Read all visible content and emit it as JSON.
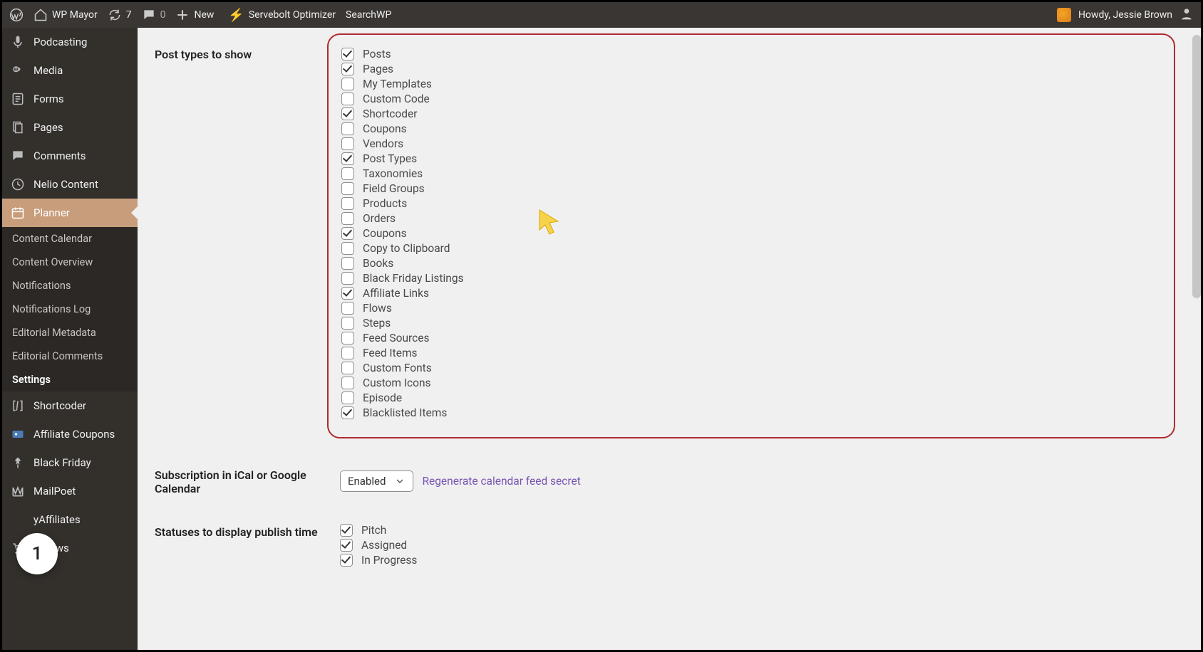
{
  "adminbar": {
    "site_name": "WP Mayor",
    "updates_count": "7",
    "comments_count": "0",
    "new_label": "New",
    "servebolt_label": "Servebolt Optimizer",
    "searchwp_label": "SearchWP",
    "howdy": "Howdy, Jessie Brown"
  },
  "sidebar": {
    "items": [
      {
        "label": "Podcasting",
        "icon": "mic"
      },
      {
        "label": "Media",
        "icon": "media"
      },
      {
        "label": "Forms",
        "icon": "form"
      },
      {
        "label": "Pages",
        "icon": "pages"
      },
      {
        "label": "Comments",
        "icon": "comment"
      },
      {
        "label": "Nelio Content",
        "icon": "clock"
      },
      {
        "label": "Planner",
        "icon": "calendar",
        "current": true
      },
      {
        "label": "Shortcoder",
        "icon": "brackets"
      },
      {
        "label": "Affiliate Coupons",
        "icon": "coupon"
      },
      {
        "label": "Black Friday",
        "icon": "pin"
      },
      {
        "label": "MailPoet",
        "icon": "mailpoet"
      },
      {
        "label": "yAffiliates",
        "icon": "blank"
      },
      {
        "label": "rtFlows",
        "icon": "cart"
      }
    ],
    "submenu": [
      {
        "label": "Content Calendar"
      },
      {
        "label": "Content Overview"
      },
      {
        "label": "Notifications"
      },
      {
        "label": "Notifications Log"
      },
      {
        "label": "Editorial Metadata"
      },
      {
        "label": "Editorial Comments"
      },
      {
        "label": "Settings",
        "current": true
      }
    ]
  },
  "settings": {
    "post_types": {
      "label": "Post types to show",
      "items": [
        {
          "label": "Posts",
          "checked": true
        },
        {
          "label": "Pages",
          "checked": true
        },
        {
          "label": "My Templates",
          "checked": false
        },
        {
          "label": "Custom Code",
          "checked": false
        },
        {
          "label": "Shortcoder",
          "checked": true
        },
        {
          "label": "Coupons",
          "checked": false
        },
        {
          "label": "Vendors",
          "checked": false
        },
        {
          "label": "Post Types",
          "checked": true
        },
        {
          "label": "Taxonomies",
          "checked": false
        },
        {
          "label": "Field Groups",
          "checked": false
        },
        {
          "label": "Products",
          "checked": false
        },
        {
          "label": "Orders",
          "checked": false
        },
        {
          "label": "Coupons",
          "checked": true
        },
        {
          "label": "Copy to Clipboard",
          "checked": false
        },
        {
          "label": "Books",
          "checked": false
        },
        {
          "label": "Black Friday Listings",
          "checked": false
        },
        {
          "label": "Affiliate Links",
          "checked": true
        },
        {
          "label": "Flows",
          "checked": false
        },
        {
          "label": "Steps",
          "checked": false
        },
        {
          "label": "Feed Sources",
          "checked": false
        },
        {
          "label": "Feed Items",
          "checked": false
        },
        {
          "label": "Custom Fonts",
          "checked": false
        },
        {
          "label": "Custom Icons",
          "checked": false
        },
        {
          "label": "Episode",
          "checked": false
        },
        {
          "label": "Blacklisted Items",
          "checked": true
        }
      ]
    },
    "subscription": {
      "label": "Subscription in iCal or Google Calendar",
      "selected": "Enabled",
      "regen_label": "Regenerate calendar feed secret"
    },
    "statuses": {
      "label": "Statuses to display publish time",
      "items": [
        {
          "label": "Pitch",
          "checked": true
        },
        {
          "label": "Assigned",
          "checked": true
        },
        {
          "label": "In Progress",
          "checked": true
        }
      ]
    }
  },
  "badge": "1"
}
